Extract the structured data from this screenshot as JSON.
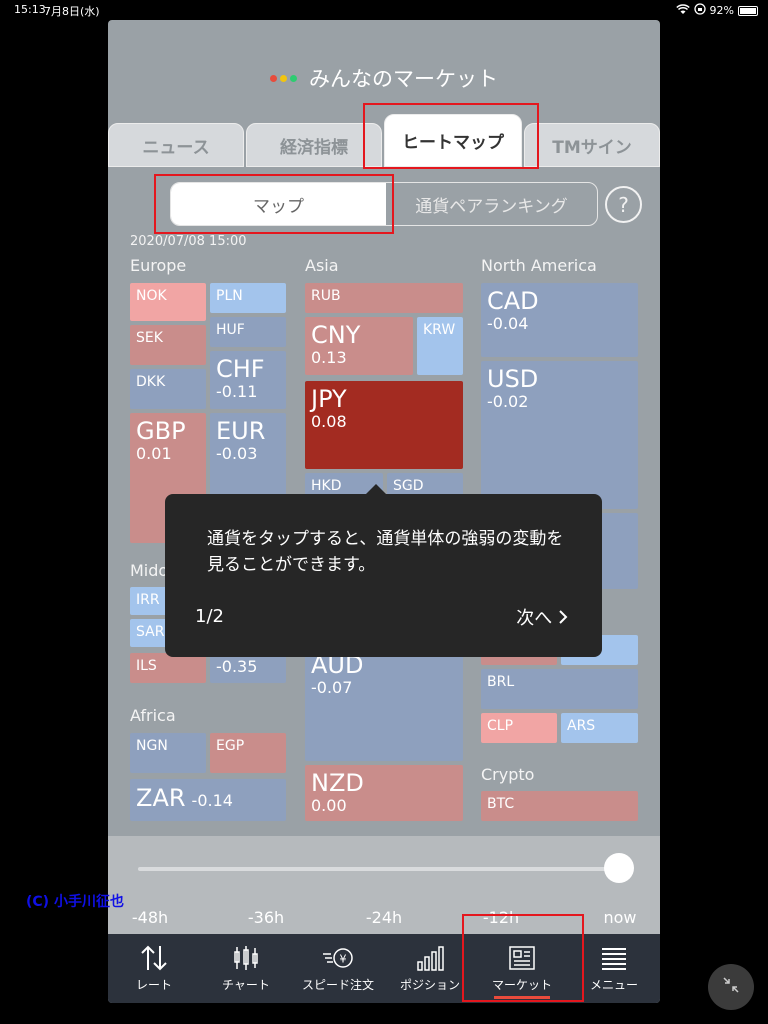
{
  "status": {
    "time": "15:13",
    "date": "7月8日(水)",
    "battery": "92%"
  },
  "header": {
    "title": "みんなのマーケット",
    "logo_colors": [
      "#e74c3c",
      "#f1c40f",
      "#2ecc71"
    ]
  },
  "tabs": [
    {
      "label": "ニュース"
    },
    {
      "label": "経済指標"
    },
    {
      "label": "ヒートマップ"
    },
    {
      "label": "TMサイン"
    }
  ],
  "segment": {
    "map": "マップ",
    "ranking": "通貨ペアランキング",
    "help": "?"
  },
  "timestamp": "2020/07/08 15:00",
  "regions": {
    "europe": "Europe",
    "asia": "Asia",
    "north_america": "North America",
    "middle_east": "Mido",
    "africa": "Africa",
    "crypto": "Crypto"
  },
  "tiles": {
    "nok": "NOK",
    "pln": "PLN",
    "sek": "SEK",
    "huf": "HUF",
    "dkk": "DKK",
    "chf": "CHF",
    "chf_val": "-0.11",
    "gbp": "GBP",
    "gbp_val": "0.01",
    "eur": "EUR",
    "eur_val": "-0.03",
    "rub": "RUB",
    "cny": "CNY",
    "cny_val": "0.13",
    "krw": "KRW",
    "jpy": "JPY",
    "jpy_val": "0.08",
    "hkd": "HKD",
    "sgd": "SGD",
    "cad": "CAD",
    "cad_val": "-0.04",
    "usd": "USD",
    "usd_val": "-0.02",
    "irr": "IRR",
    "sar": "SAR",
    "ils": "ILS",
    "mid_val": "-0.35",
    "aud": "AUD",
    "aud_val": "-0.07",
    "nzd": "NZD",
    "nzd_val": "0.00",
    "ngn": "NGN",
    "egp": "EGP",
    "zar": "ZAR",
    "zar_val": "-0.14",
    "brl": "BRL",
    "clp": "CLP",
    "ars": "ARS",
    "btc": "BTC"
  },
  "tooltip": {
    "message": "通貨をタップすると、通貨単体の強弱の変動を見ることができます。",
    "page": "1/2",
    "next": "次へ"
  },
  "slider": {
    "ticks": [
      "-48h",
      "-36h",
      "-24h",
      "-12h",
      "now"
    ],
    "value": "now"
  },
  "nav": [
    {
      "label": "レート"
    },
    {
      "label": "チャート"
    },
    {
      "label": "スピード注文"
    },
    {
      "label": "ポジション"
    },
    {
      "label": "マーケット"
    },
    {
      "label": "メニュー"
    }
  ],
  "copyright": "(C) 小手川征也"
}
